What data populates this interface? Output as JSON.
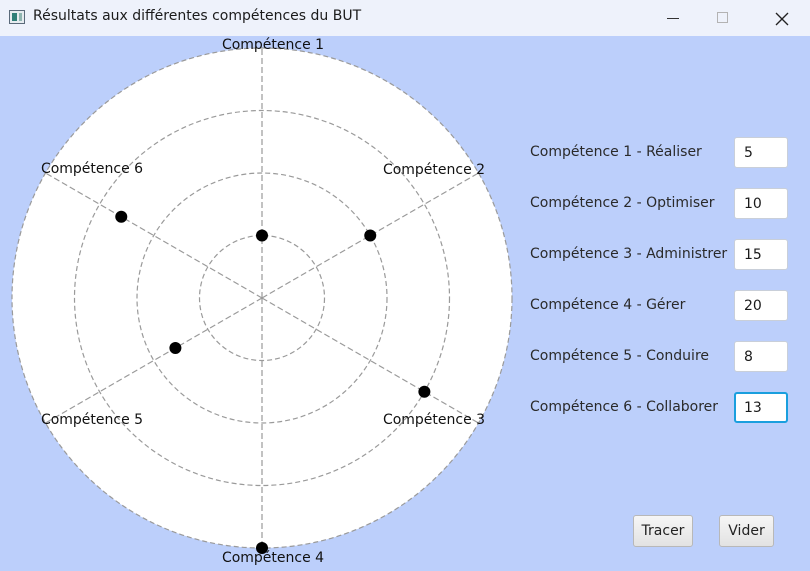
{
  "window": {
    "title": "Résultats aux différentes compétences du BUT",
    "icon": "app-window-icon",
    "controls": [
      "minimize-icon",
      "maximize-icon",
      "close-icon"
    ]
  },
  "chart_data": {
    "type": "radar",
    "axes": [
      "Compétence 1",
      "Compétence 2",
      "Compétence 3",
      "Compétence 4",
      "Compétence 5",
      "Compétence 6"
    ],
    "values": [
      5,
      10,
      15,
      20,
      8,
      13
    ],
    "rmax": 20,
    "rings": [
      5,
      10,
      15,
      20
    ],
    "grid": true,
    "point_color": "#000000"
  },
  "form": {
    "fields": [
      {
        "label": "Compétence 1 - Réaliser",
        "value": "5"
      },
      {
        "label": "Compétence 2 - Optimiser",
        "value": "10"
      },
      {
        "label": "Compétence 3 - Administrer",
        "value": "15"
      },
      {
        "label": "Compétence 4 - Gérer",
        "value": "20"
      },
      {
        "label": "Compétence 5 - Conduire",
        "value": "8"
      },
      {
        "label": "Compétence 6 - Collaborer",
        "value": "13",
        "focused": true
      }
    ]
  },
  "buttons": {
    "plot": "Tracer",
    "clear": "Vider"
  },
  "colors": {
    "background": "#bccffb",
    "titlebar": "#eef2fb",
    "focus": "#1a9fde",
    "grid": "#9a9a9a"
  }
}
